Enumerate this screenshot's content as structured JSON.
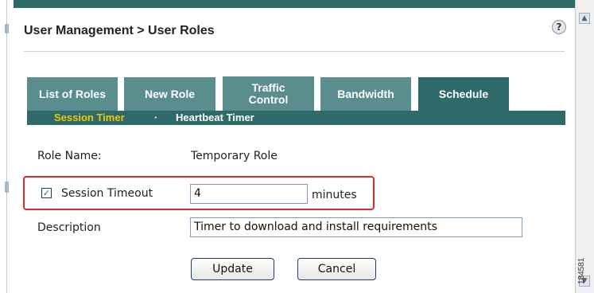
{
  "header": {
    "title": "User Management > User Roles",
    "help_icon": "help-icon"
  },
  "tabs": [
    {
      "label": "List of Roles",
      "active": false
    },
    {
      "label": "New Role",
      "active": false
    },
    {
      "label": "Traffic Control",
      "active": false
    },
    {
      "label": "Bandwidth",
      "active": false
    },
    {
      "label": "Schedule",
      "active": true
    }
  ],
  "subnav": {
    "items": [
      "Session Timer",
      "Heartbeat Timer"
    ],
    "active": "Session Timer",
    "separator": "·"
  },
  "form": {
    "role_name_label": "Role Name:",
    "role_name_value": "Temporary Role",
    "session_timeout_label": "Session Timeout",
    "session_timeout_checked": true,
    "session_timeout_value": "4",
    "minutes_label": "minutes",
    "description_label": "Description",
    "description_value": "Timer to download and install requirements"
  },
  "buttons": {
    "update": "Update",
    "cancel": "Cancel"
  },
  "figure_number": "184581",
  "colors": {
    "tab_bg": "#5a8e8e",
    "tab_active_bg": "#2f6a6a",
    "subnav_active": "#f2c500",
    "highlight_border": "#e02a2a"
  }
}
